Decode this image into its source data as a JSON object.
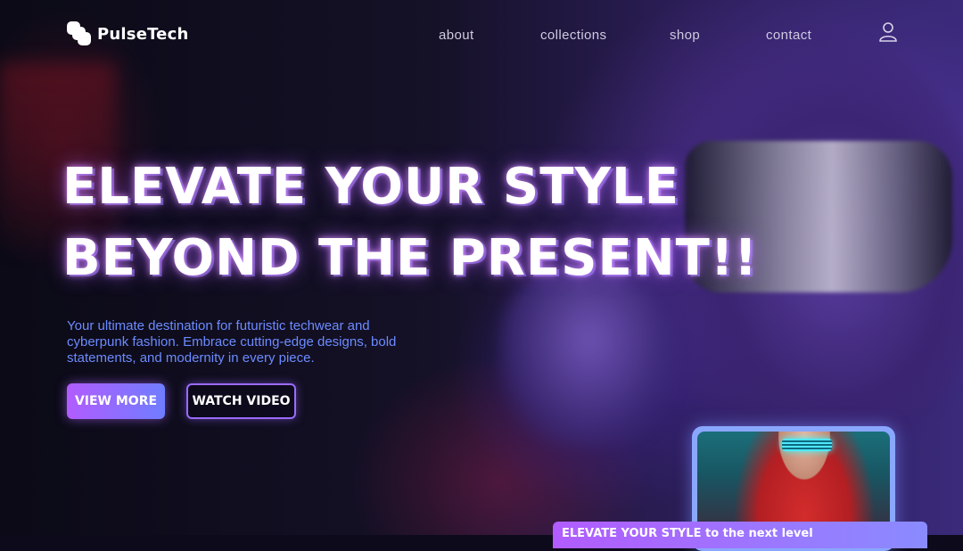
{
  "brand": {
    "name": "PulseTech"
  },
  "nav": {
    "links": [
      "about",
      "collections",
      "shop",
      "contact"
    ],
    "account_icon": "user-icon"
  },
  "hero": {
    "title_line1": "ELEVATE YOUR STYLE",
    "title_line2": "BEYOND THE PRESENT!!",
    "subtitle": "Your ultimate destination for futuristic techwear and cyberpunk fashion. Embrace cutting-edge designs, bold statements, and modernity in every piece.",
    "primary_button": "VIEW MORE",
    "secondary_button": "WATCH VIDEO"
  },
  "banner": {
    "text": "ELEVATE YOUR STYLE to the next level"
  },
  "colors": {
    "accent_purple": "#b25cff",
    "accent_blue": "#6c8bff",
    "background": "#0d0a1c"
  }
}
